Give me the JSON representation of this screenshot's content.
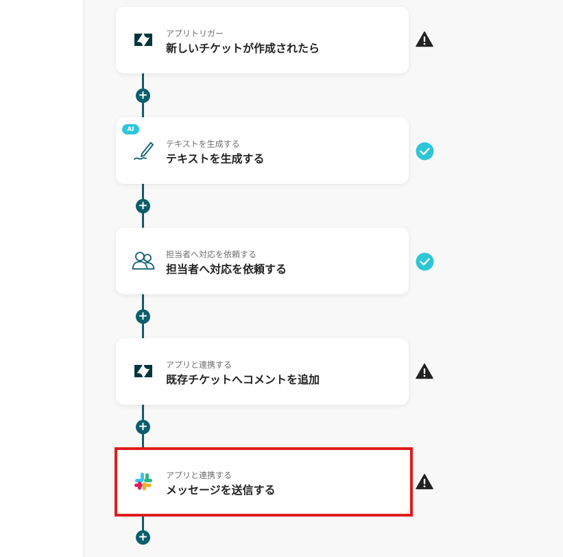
{
  "flow": {
    "steps": [
      {
        "subtitle": "アプリトリガー",
        "title": "新しいチケットが作成されたら",
        "icon": "zendesk-logo-icon",
        "status": "warning"
      },
      {
        "subtitle": "テキストを生成する",
        "title": "テキストを生成する",
        "icon": "pen-icon",
        "badge": "AI",
        "status": "complete"
      },
      {
        "subtitle": "担当者へ対応を依頼する",
        "title": "担当者へ対応を依頼する",
        "icon": "users-icon",
        "status": "complete"
      },
      {
        "subtitle": "アプリと連携する",
        "title": "既存チケットへコメントを追加",
        "icon": "zendesk-logo-icon",
        "status": "warning"
      },
      {
        "subtitle": "アプリと連携する",
        "title": "メッセージを送信する",
        "icon": "slack-logo-icon",
        "status": "warning"
      }
    ],
    "add_button_symbol": "+"
  },
  "colors": {
    "connector": "#0b5e6c",
    "complete": "#2cc6d6",
    "warning": "#222222",
    "highlight": "#e01b1b",
    "ai_badge": "#2cc6d6"
  }
}
